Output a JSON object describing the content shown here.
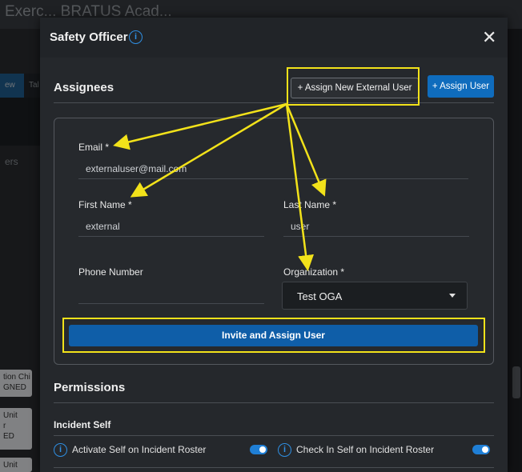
{
  "background": {
    "app_title": "Exerc... BRATUS Acad...",
    "tab_active": "ew",
    "tab_other": "Tal",
    "members_label": "ers",
    "cards": [
      "tion Chi\nGNED",
      "Unit\nr\nED",
      "Unit"
    ]
  },
  "modal": {
    "title": "Safety Officer",
    "close_label": "✕",
    "assignees": {
      "heading": "Assignees",
      "assign_external_label": "+ Assign New External User",
      "assign_user_label": "+ Assign User"
    },
    "form": {
      "email_label": "Email *",
      "email_value": "externaluser@mail.com",
      "first_name_label": "First Name *",
      "first_name_value": "external",
      "last_name_label": "Last Name *",
      "last_name_value": "user",
      "phone_label": "Phone Number",
      "phone_value": "",
      "org_label": "Organization *",
      "org_value": "Test OGA",
      "invite_label": "Invite and Assign User"
    },
    "permissions": {
      "heading": "Permissions",
      "group_title": "Incident Self",
      "items": [
        {
          "label": "Activate Self on Incident Roster",
          "enabled": true
        },
        {
          "label": "Check In Self on Incident Roster",
          "enabled": true
        }
      ]
    }
  },
  "colors": {
    "accent": "#0f6cbd",
    "annotation": "#f2e21a",
    "info_icon": "#2f8fe3"
  },
  "icons": {
    "info": "info-circle-icon",
    "close": "close-icon",
    "dropdown": "chevron-down-icon"
  }
}
